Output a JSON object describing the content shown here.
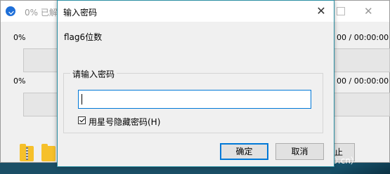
{
  "background_window": {
    "title": "0% 已解",
    "rows": [
      {
        "percent": "0%",
        "time": "00 / 00:00:00"
      },
      {
        "percent": "0%",
        "time": "00 / 00:00:00"
      }
    ],
    "button_partial": "停止",
    "watermark": "安全客（bobao.360.cn）",
    "icons": [
      "app-icon",
      "zip-folder-icon",
      "folder-icon"
    ]
  },
  "dialog": {
    "title": "输入密码",
    "close_glyph": "✕",
    "hint": "flag6位数",
    "group_label": "请输入密码",
    "password_value": "",
    "checkbox_label": "用星号隐藏密码(H)",
    "checkbox_checked": true,
    "ok_label": "确定",
    "cancel_label": "取消",
    "accent_color": "#0078d7"
  }
}
